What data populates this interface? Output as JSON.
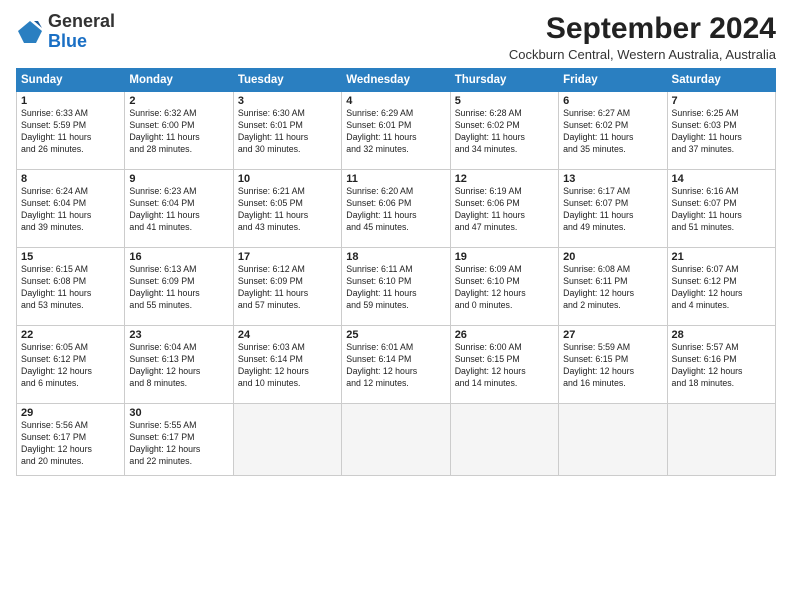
{
  "logo": {
    "general": "General",
    "blue": "Blue"
  },
  "title": "September 2024",
  "subtitle": "Cockburn Central, Western Australia, Australia",
  "days_of_week": [
    "Sunday",
    "Monday",
    "Tuesday",
    "Wednesday",
    "Thursday",
    "Friday",
    "Saturday"
  ],
  "weeks": [
    [
      {
        "day": "1",
        "lines": [
          "Sunrise: 6:33 AM",
          "Sunset: 5:59 PM",
          "Daylight: 11 hours",
          "and 26 minutes."
        ]
      },
      {
        "day": "2",
        "lines": [
          "Sunrise: 6:32 AM",
          "Sunset: 6:00 PM",
          "Daylight: 11 hours",
          "and 28 minutes."
        ]
      },
      {
        "day": "3",
        "lines": [
          "Sunrise: 6:30 AM",
          "Sunset: 6:01 PM",
          "Daylight: 11 hours",
          "and 30 minutes."
        ]
      },
      {
        "day": "4",
        "lines": [
          "Sunrise: 6:29 AM",
          "Sunset: 6:01 PM",
          "Daylight: 11 hours",
          "and 32 minutes."
        ]
      },
      {
        "day": "5",
        "lines": [
          "Sunrise: 6:28 AM",
          "Sunset: 6:02 PM",
          "Daylight: 11 hours",
          "and 34 minutes."
        ]
      },
      {
        "day": "6",
        "lines": [
          "Sunrise: 6:27 AM",
          "Sunset: 6:02 PM",
          "Daylight: 11 hours",
          "and 35 minutes."
        ]
      },
      {
        "day": "7",
        "lines": [
          "Sunrise: 6:25 AM",
          "Sunset: 6:03 PM",
          "Daylight: 11 hours",
          "and 37 minutes."
        ]
      }
    ],
    [
      {
        "day": "8",
        "lines": [
          "Sunrise: 6:24 AM",
          "Sunset: 6:04 PM",
          "Daylight: 11 hours",
          "and 39 minutes."
        ]
      },
      {
        "day": "9",
        "lines": [
          "Sunrise: 6:23 AM",
          "Sunset: 6:04 PM",
          "Daylight: 11 hours",
          "and 41 minutes."
        ]
      },
      {
        "day": "10",
        "lines": [
          "Sunrise: 6:21 AM",
          "Sunset: 6:05 PM",
          "Daylight: 11 hours",
          "and 43 minutes."
        ]
      },
      {
        "day": "11",
        "lines": [
          "Sunrise: 6:20 AM",
          "Sunset: 6:06 PM",
          "Daylight: 11 hours",
          "and 45 minutes."
        ]
      },
      {
        "day": "12",
        "lines": [
          "Sunrise: 6:19 AM",
          "Sunset: 6:06 PM",
          "Daylight: 11 hours",
          "and 47 minutes."
        ]
      },
      {
        "day": "13",
        "lines": [
          "Sunrise: 6:17 AM",
          "Sunset: 6:07 PM",
          "Daylight: 11 hours",
          "and 49 minutes."
        ]
      },
      {
        "day": "14",
        "lines": [
          "Sunrise: 6:16 AM",
          "Sunset: 6:07 PM",
          "Daylight: 11 hours",
          "and 51 minutes."
        ]
      }
    ],
    [
      {
        "day": "15",
        "lines": [
          "Sunrise: 6:15 AM",
          "Sunset: 6:08 PM",
          "Daylight: 11 hours",
          "and 53 minutes."
        ]
      },
      {
        "day": "16",
        "lines": [
          "Sunrise: 6:13 AM",
          "Sunset: 6:09 PM",
          "Daylight: 11 hours",
          "and 55 minutes."
        ]
      },
      {
        "day": "17",
        "lines": [
          "Sunrise: 6:12 AM",
          "Sunset: 6:09 PM",
          "Daylight: 11 hours",
          "and 57 minutes."
        ]
      },
      {
        "day": "18",
        "lines": [
          "Sunrise: 6:11 AM",
          "Sunset: 6:10 PM",
          "Daylight: 11 hours",
          "and 59 minutes."
        ]
      },
      {
        "day": "19",
        "lines": [
          "Sunrise: 6:09 AM",
          "Sunset: 6:10 PM",
          "Daylight: 12 hours",
          "and 0 minutes."
        ]
      },
      {
        "day": "20",
        "lines": [
          "Sunrise: 6:08 AM",
          "Sunset: 6:11 PM",
          "Daylight: 12 hours",
          "and 2 minutes."
        ]
      },
      {
        "day": "21",
        "lines": [
          "Sunrise: 6:07 AM",
          "Sunset: 6:12 PM",
          "Daylight: 12 hours",
          "and 4 minutes."
        ]
      }
    ],
    [
      {
        "day": "22",
        "lines": [
          "Sunrise: 6:05 AM",
          "Sunset: 6:12 PM",
          "Daylight: 12 hours",
          "and 6 minutes."
        ]
      },
      {
        "day": "23",
        "lines": [
          "Sunrise: 6:04 AM",
          "Sunset: 6:13 PM",
          "Daylight: 12 hours",
          "and 8 minutes."
        ]
      },
      {
        "day": "24",
        "lines": [
          "Sunrise: 6:03 AM",
          "Sunset: 6:14 PM",
          "Daylight: 12 hours",
          "and 10 minutes."
        ]
      },
      {
        "day": "25",
        "lines": [
          "Sunrise: 6:01 AM",
          "Sunset: 6:14 PM",
          "Daylight: 12 hours",
          "and 12 minutes."
        ]
      },
      {
        "day": "26",
        "lines": [
          "Sunrise: 6:00 AM",
          "Sunset: 6:15 PM",
          "Daylight: 12 hours",
          "and 14 minutes."
        ]
      },
      {
        "day": "27",
        "lines": [
          "Sunrise: 5:59 AM",
          "Sunset: 6:15 PM",
          "Daylight: 12 hours",
          "and 16 minutes."
        ]
      },
      {
        "day": "28",
        "lines": [
          "Sunrise: 5:57 AM",
          "Sunset: 6:16 PM",
          "Daylight: 12 hours",
          "and 18 minutes."
        ]
      }
    ],
    [
      {
        "day": "29",
        "lines": [
          "Sunrise: 5:56 AM",
          "Sunset: 6:17 PM",
          "Daylight: 12 hours",
          "and 20 minutes."
        ]
      },
      {
        "day": "30",
        "lines": [
          "Sunrise: 5:55 AM",
          "Sunset: 6:17 PM",
          "Daylight: 12 hours",
          "and 22 minutes."
        ]
      },
      {
        "day": "",
        "lines": []
      },
      {
        "day": "",
        "lines": []
      },
      {
        "day": "",
        "lines": []
      },
      {
        "day": "",
        "lines": []
      },
      {
        "day": "",
        "lines": []
      }
    ]
  ]
}
